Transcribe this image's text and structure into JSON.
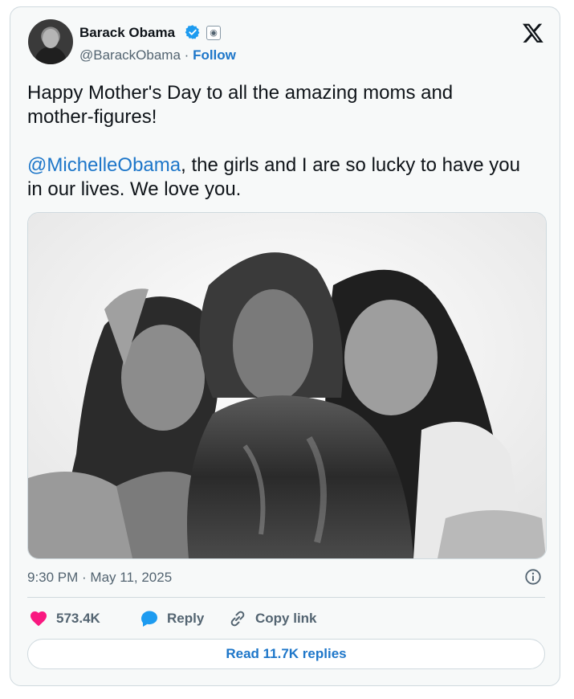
{
  "author": {
    "name": "Barack Obama",
    "handle": "@BarackObama",
    "separator": "·",
    "follow_label": "Follow"
  },
  "tweet": {
    "line1": "Happy Mother's Day to all the amazing moms and",
    "line2": "mother-figures!",
    "mention": "@MichelleObama",
    "line3_rest": ", the girls and I are so lucky to have you",
    "line4": "in our lives. We love you."
  },
  "timestamp": "9:30 PM · May 11, 2025",
  "actions": {
    "likes": "573.4K",
    "reply_label": "Reply",
    "copy_label": "Copy link"
  },
  "read_replies": "Read 11.7K replies",
  "icons": {
    "verified": "verified-badge-icon",
    "seal": "government-seal-icon",
    "x": "x-logo-icon",
    "info": "info-icon",
    "heart": "heart-icon",
    "reply": "reply-bubble-icon",
    "link": "link-icon"
  },
  "colors": {
    "link": "#1d76c9",
    "heart": "#f91880",
    "muted": "#536471",
    "text": "#0f1419",
    "border": "#cfd9de",
    "verified": "#1d9bf0"
  }
}
